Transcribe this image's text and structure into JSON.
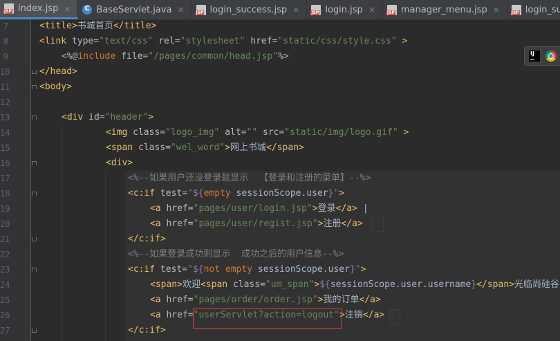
{
  "tabs": [
    {
      "label": "index.jsp",
      "type": "jsp",
      "active": true
    },
    {
      "label": "BaseServlet.java",
      "type": "java",
      "active": false
    },
    {
      "label": "login_success.jsp",
      "type": "jsp",
      "active": false
    },
    {
      "label": "login.jsp",
      "type": "jsp",
      "active": false
    },
    {
      "label": "manager_menu.jsp",
      "type": "jsp",
      "active": false
    },
    {
      "label": "login_success_menu.jsp",
      "type": "jsp",
      "active": false
    }
  ],
  "close_glyph": "×",
  "line_numbers": [
    "7",
    "8",
    "9",
    "10",
    "11",
    "12",
    "13",
    "14",
    "15",
    "16",
    "17",
    "18",
    "19",
    "20",
    "21",
    "22",
    "23",
    "24",
    "25",
    "26",
    "27"
  ],
  "code": {
    "l7": [
      "<title>",
      "书城首页",
      "</title>"
    ],
    "l8": [
      "<link ",
      "type=",
      "\"text/css\"",
      " rel=",
      "\"stylesheet\"",
      " href=",
      "\"static/css/style.css\"",
      " >"
    ],
    "l9": [
      "<%@",
      "include",
      " file=",
      "\"/pages/common/head.jsp\"",
      "%>"
    ],
    "l10": [
      "</head>"
    ],
    "l11": [
      "<body>"
    ],
    "l13": [
      "<div ",
      "id=",
      "\"header\"",
      ">"
    ],
    "l14": [
      "<img ",
      "class=",
      "\"logo_img\"",
      " alt=",
      "\"\"",
      " src=",
      "\"static/img/logo.gif\"",
      " >"
    ],
    "l15": [
      "<span ",
      "class=",
      "\"wel_word\"",
      ">",
      "网上书城",
      "</span>"
    ],
    "l16": [
      "<div>"
    ],
    "l17": [
      "<%--如果用户还没登录就显示  【登录和注册的菜单】--%>"
    ],
    "l18": [
      "<c:if ",
      "test=",
      "\"",
      "${",
      "empty",
      " sessionScope.user",
      "}",
      "\"",
      ">"
    ],
    "l19": [
      "<a ",
      "href=",
      "\"pages/user/login.jsp\"",
      ">",
      "登录",
      "</a>",
      " |"
    ],
    "l20": [
      "<a ",
      "href=",
      "\"pages/user/regist.jsp\"",
      ">",
      "注册",
      "</a>"
    ],
    "l21": [
      "</c:if>"
    ],
    "l22": [
      "<%--如果登录成功则显示  成功之后的用户信息--%>"
    ],
    "l23": [
      "<c:if ",
      "test=",
      "\"",
      "${",
      "not empty",
      " sessionScope.user",
      "}",
      "\"",
      ">"
    ],
    "l24": [
      "<span>",
      "欢迎",
      "<span ",
      "class=",
      "\"um_span\"",
      ">",
      "${",
      "sessionScope.user.username",
      "}",
      "</span>",
      "光临尚硅谷"
    ],
    "l25": [
      "<a ",
      "href=",
      "\"pages/order/order.jsp\"",
      ">",
      "我的订单",
      "</a>"
    ],
    "l26": [
      "<a ",
      "href=",
      "\"userServlet?action=logout\"",
      ">",
      "注销",
      "</a>"
    ],
    "l27": [
      "</c:if>"
    ]
  },
  "colors": {
    "background": "#2b2b2b",
    "tag": "#e8bf6a",
    "string": "#6a8759",
    "keyword": "#cc7832",
    "comment": "#808080",
    "el": "#9876aa",
    "highlight_box": "#e03c3c"
  },
  "browser_icons": [
    "intellij-icon",
    "chrome-icon"
  ]
}
